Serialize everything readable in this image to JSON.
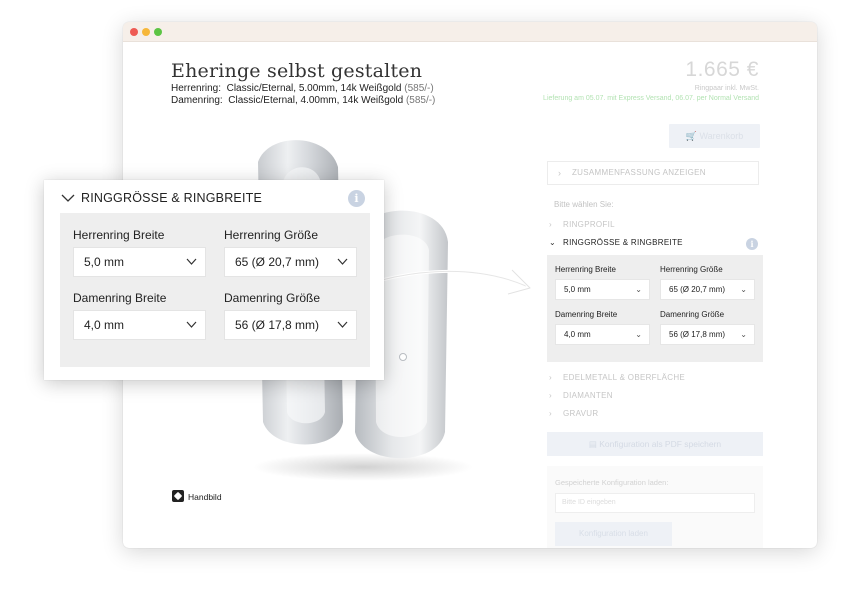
{
  "header": {
    "title": "Eheringe selbst gestalten",
    "herrenring_label": "Herrenring:",
    "herrenring_text": "Classic/Eternal, 5.00mm, 14k Weißgold",
    "herrenring_alloy": "(585/-)",
    "damenring_label": "Damenring:",
    "damenring_text": "Classic/Eternal, 4.00mm, 14k Weißgold",
    "damenring_alloy": "(585/-)"
  },
  "pricing": {
    "price": "1.665 €",
    "note": "Ringpaar inkl. MwSt.",
    "delivery": "Lieferung am 05.07. mit Express Versand, 06.07. per Normal Versand",
    "cart_button": "Warenkorb"
  },
  "sidebar": {
    "summary_button": "ZUSAMMENFASSUNG ANZEIGEN",
    "pick_label": "Bitte wählen Sie:",
    "accordion": [
      {
        "label": "RINGPROFIL"
      },
      {
        "label": "RINGGRÖSSE & RINGBREITE"
      },
      {
        "label": "EDELMETALL & OBERFLÄCHE"
      },
      {
        "label": "DIAMANTEN"
      },
      {
        "label": "GRAVUR"
      }
    ],
    "pdf_button": "Konfiguration als PDF speichern",
    "saved_label": "Gespeicherte Konfiguration laden:",
    "saved_placeholder": "Bitte ID eingeben",
    "saved_button": "Konfiguration laden"
  },
  "sizes": {
    "section_title": "RINGGRÖSSE & RINGBREITE",
    "herren_breite_label": "Herrenring Breite",
    "herren_breite_value": "5,0 mm",
    "herren_groesse_label": "Herrenring Größe",
    "herren_groesse_value": "65 (Ø 20,7 mm)",
    "damen_breite_label": "Damenring Breite",
    "damen_breite_value": "4,0 mm",
    "damen_groesse_label": "Damenring Größe",
    "damen_groesse_value": "56 (Ø 17,8 mm)"
  },
  "image": {
    "handbild_label": "Handbild"
  },
  "icons": [
    "chevron-right-icon",
    "chevron-down-icon",
    "info-icon",
    "cart-icon",
    "pdf-icon",
    "hand-icon"
  ],
  "colors": {
    "info_accent": "#c9d3e2",
    "panel_bg": "#eeeeee",
    "delivery_green": "#b3e3b3"
  }
}
